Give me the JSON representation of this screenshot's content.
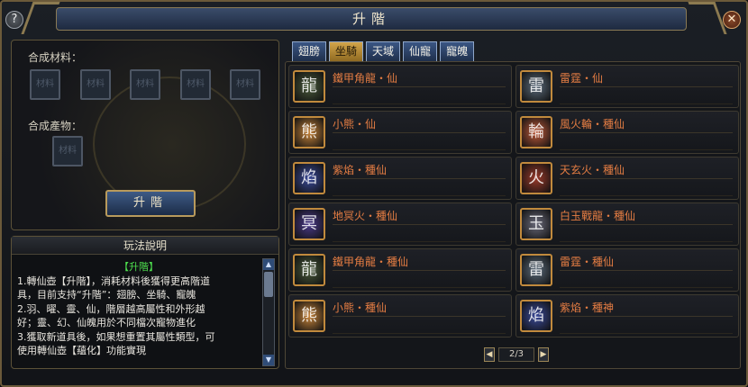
{
  "window": {
    "title": "升階",
    "help_label": "?",
    "close_label": "✕"
  },
  "synthesis": {
    "materials_label": "合成材料：",
    "product_label": "合成產物：",
    "slot_text": "材料",
    "upgrade_button": "升階"
  },
  "instructions": {
    "title": "玩法說明",
    "heading": "【升階】",
    "lines": [
      "1.轉仙壺【升階】，消耗材料後獲得更高階道",
      "具，目前支持“升階”：翅膀、坐騎、寵魄",
      " 2.羽、曜、靈、仙，階層越高屬性和外形越",
      "好；靈、幻、仙魄用於不同檔次寵物進化",
      "3.獲取新道具後，如果想重置其屬性類型，可",
      "使用轉仙壺【蘊化】功能實現"
    ]
  },
  "tabs": [
    "翅膀",
    "坐騎",
    "天域",
    "仙寵",
    "寵魄"
  ],
  "active_tab": 1,
  "items": [
    {
      "name": "鐵甲角龍・仙",
      "icon": "mount-armored-dragon-icon",
      "color": "#4a5a3a",
      "glyph": "龍"
    },
    {
      "name": "雷霆・仙",
      "icon": "mount-thunder-icon",
      "color": "#5a6a7a",
      "glyph": "雷"
    },
    {
      "name": "小熊・仙",
      "icon": "mount-bear-icon",
      "color": "#c7843a",
      "glyph": "熊"
    },
    {
      "name": "風火輪・種仙",
      "icon": "mount-wind-fire-wheel-icon",
      "color": "#c05a3a",
      "glyph": "輪"
    },
    {
      "name": "紫焰・種仙",
      "icon": "mount-purple-flame-icon",
      "color": "#3a4a9a",
      "glyph": "焰"
    },
    {
      "name": "天玄火・種仙",
      "icon": "mount-heaven-fire-icon",
      "color": "#9a3a2a",
      "glyph": "火"
    },
    {
      "name": "地冥火・種仙",
      "icon": "mount-earth-fire-icon",
      "color": "#4a3a8a",
      "glyph": "冥"
    },
    {
      "name": "白玉戰龍・種仙",
      "icon": "mount-jade-dragon-icon",
      "color": "#6a6a7a",
      "glyph": "玉"
    },
    {
      "name": "鐵甲角龍・種仙",
      "icon": "mount-armored-dragon-icon",
      "color": "#4a5a3a",
      "glyph": "龍"
    },
    {
      "name": "雷霆・種仙",
      "icon": "mount-thunder-icon",
      "color": "#5a6a7a",
      "glyph": "雷"
    },
    {
      "name": "小熊・種仙",
      "icon": "mount-bear-icon",
      "color": "#c7843a",
      "glyph": "熊"
    },
    {
      "name": "紫焰・種神",
      "icon": "mount-purple-flame-icon",
      "color": "#3a4a9a",
      "glyph": "焰"
    }
  ],
  "pager": {
    "current": "2/3",
    "prev": "◀",
    "next": "▶"
  },
  "colors": {
    "item_name": "#e57d43",
    "heading": "#4ee04e",
    "active_tab": "#d3a54a"
  }
}
